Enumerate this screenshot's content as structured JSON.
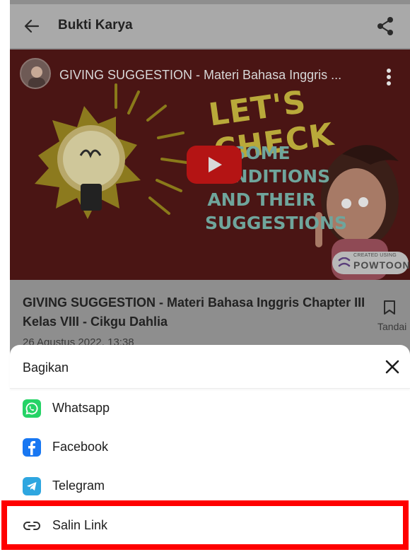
{
  "app_bar": {
    "title": "Bukti Karya",
    "back_icon": "arrow-left-icon",
    "share_icon": "share-icon"
  },
  "video": {
    "title": "GIVING SUGGESTION - Materi Bahasa Inggris ...",
    "headline": "LET'S CHECK",
    "overlay_lines": [
      "SOME",
      "CONDITIONS",
      "AND THEIR",
      "SUGGESTIONS"
    ],
    "badge_small": "CREATED USING",
    "badge_brand": "POWTOON",
    "play_icon": "play-icon",
    "menu_icon": "more-vertical-icon"
  },
  "post": {
    "title": "GIVING SUGGESTION - Materi Bahasa Inggris Chapter III Kelas VIII - Cikgu Dahlia",
    "date": "26 Agustus 2022, 13:38",
    "bookmark_label": "Tandai",
    "bookmark_icon": "bookmark-icon"
  },
  "share_sheet": {
    "title": "Bagikan",
    "close_icon": "close-icon",
    "options": [
      {
        "label": "Whatsapp",
        "icon": "whatsapp-icon",
        "color": "#25d366"
      },
      {
        "label": "Facebook",
        "icon": "facebook-icon",
        "color": "#1877f2"
      },
      {
        "label": "Telegram",
        "icon": "telegram-icon",
        "color": "#2ea6e0"
      },
      {
        "label": "Salin Link",
        "icon": "link-icon",
        "color": "#333333"
      }
    ]
  },
  "colors": {
    "highlight": "#ff0000",
    "youtube_red": "#b41414"
  }
}
